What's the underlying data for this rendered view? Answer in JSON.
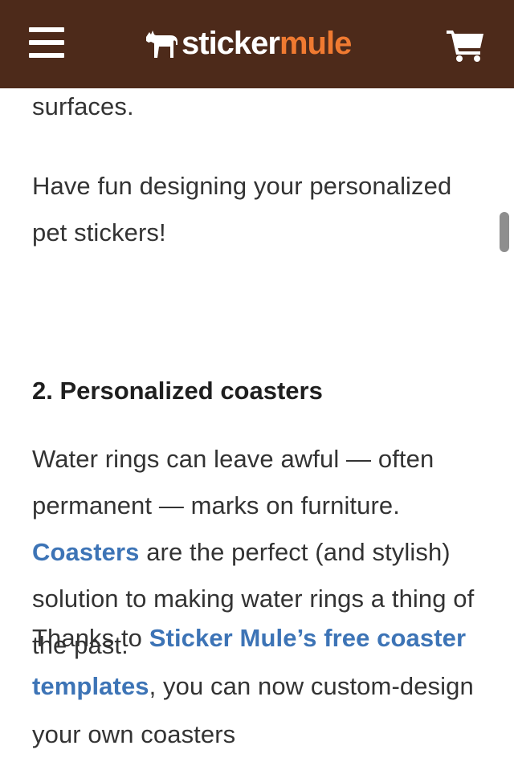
{
  "header": {
    "logo_part1": "sticker",
    "logo_part2": "mule",
    "colors": {
      "background": "#4d2a1a",
      "accent": "#f07a31"
    }
  },
  "article": {
    "p0": "surfaces.",
    "p1": "Have fun designing your personalized pet stickers!",
    "heading": "2. Personalized coasters",
    "p2_before": "Water rings can leave awful — often permanent — marks on furniture. ",
    "p2_link": "Coasters",
    "p2_after": " are the perfect (and stylish) solution to making water rings a thing of the past.",
    "p3_before": "Thanks to ",
    "p3_link": "Sticker Mule’s free coaster templates",
    "p3_after": ", you can now custom-design your own coasters"
  },
  "colors": {
    "link": "#3d74b6",
    "text": "#333333"
  }
}
